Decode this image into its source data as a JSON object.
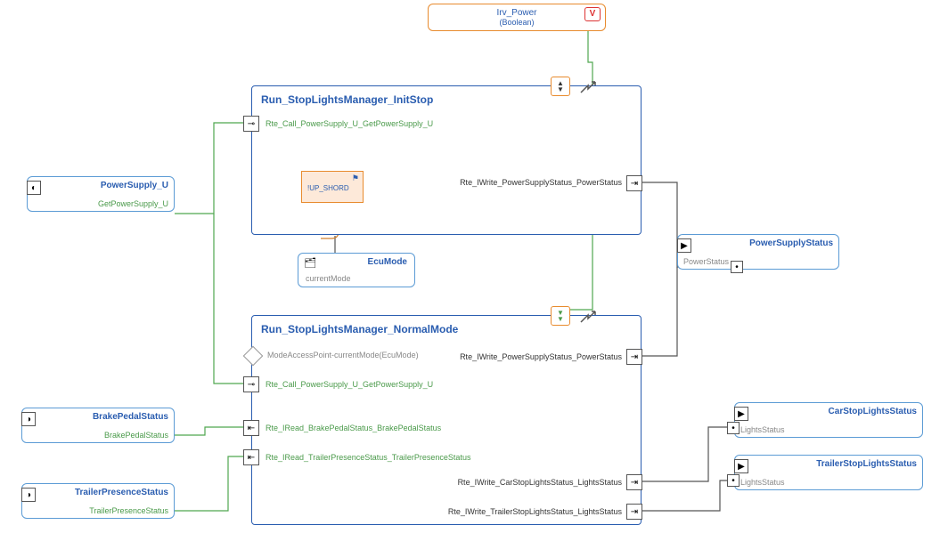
{
  "top": {
    "name": "Irv_Power",
    "type": "(Boolean)"
  },
  "leftPorts": {
    "powerSupply": {
      "title": "PowerSupply_U",
      "sub": "GetPowerSupply_U"
    },
    "brakePedal": {
      "title": "BrakePedalStatus",
      "sub": "BrakePedalStatus"
    },
    "trailerPresence": {
      "title": "TrailerPresenceStatus",
      "sub": "TrailerPresenceStatus"
    }
  },
  "rightPorts": {
    "powerStatus": {
      "title": "PowerSupplyStatus",
      "sub": "PowerStatus"
    },
    "carStop": {
      "title": "CarStopLightsStatus",
      "sub": "LightsStatus"
    },
    "trailerStop": {
      "title": "TrailerStopLightsStatus",
      "sub": "LightsStatus"
    }
  },
  "runInit": {
    "title": "Run_StopLightsManager_InitStop",
    "call": "Rte_Call_PowerSupply_U_GetPowerSupply_U",
    "write": "Rte_IWrite_PowerSupplyStatus_PowerStatus",
    "inner": "!UP_SHORD"
  },
  "ecu": {
    "title": "EcuMode",
    "sub": "currentMode"
  },
  "runNormal": {
    "title": "Run_StopLightsManager_NormalMode",
    "modeAccess": "ModeAccessPoint-currentMode(EcuMode)",
    "writePower": "Rte_IWrite_PowerSupplyStatus_PowerStatus",
    "call": "Rte_Call_PowerSupply_U_GetPowerSupply_U",
    "readBrake": "Rte_IRead_BrakePedalStatus_BrakePedalStatus",
    "readTrailer": "Rte_IRead_TrailerPresenceStatus_TrailerPresenceStatus",
    "writeCar": "Rte_IWrite_CarStopLightsStatus_LightsStatus",
    "writeTrailer": "Rte_IWrite_TrailerStopLightsStatus_LightsStatus"
  },
  "badge": "V"
}
